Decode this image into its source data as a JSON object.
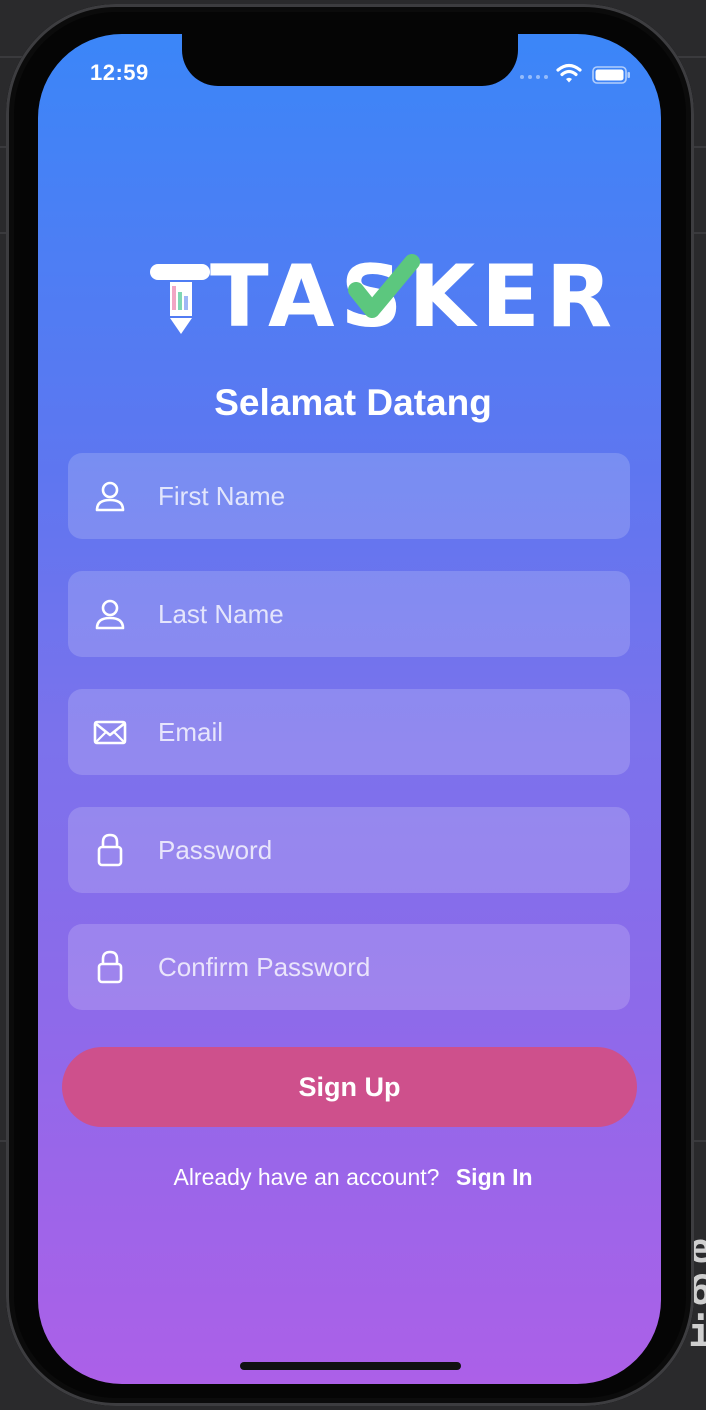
{
  "status_bar": {
    "time": "12:59"
  },
  "logo": {
    "text": "TASKER"
  },
  "welcome": "Selamat Datang",
  "form": {
    "first_name": {
      "placeholder": "First Name",
      "icon": "user-icon"
    },
    "last_name": {
      "placeholder": "Last Name",
      "icon": "user-icon"
    },
    "email": {
      "placeholder": "Email",
      "icon": "mail-icon"
    },
    "password": {
      "placeholder": "Password",
      "icon": "lock-icon"
    },
    "confirm_password": {
      "placeholder": "Confirm Password",
      "icon": "lock-icon"
    }
  },
  "signup_button": "Sign Up",
  "signin": {
    "prompt": "Already have an account?",
    "link": "Sign In"
  },
  "colors": {
    "gradient_top": "#3b86f8",
    "gradient_bottom": "#ac60e8",
    "signup_button": "#ce508c",
    "logo_check": "#5cc77e"
  },
  "backdrop_text": [
    "e",
    "6",
    "i"
  ]
}
